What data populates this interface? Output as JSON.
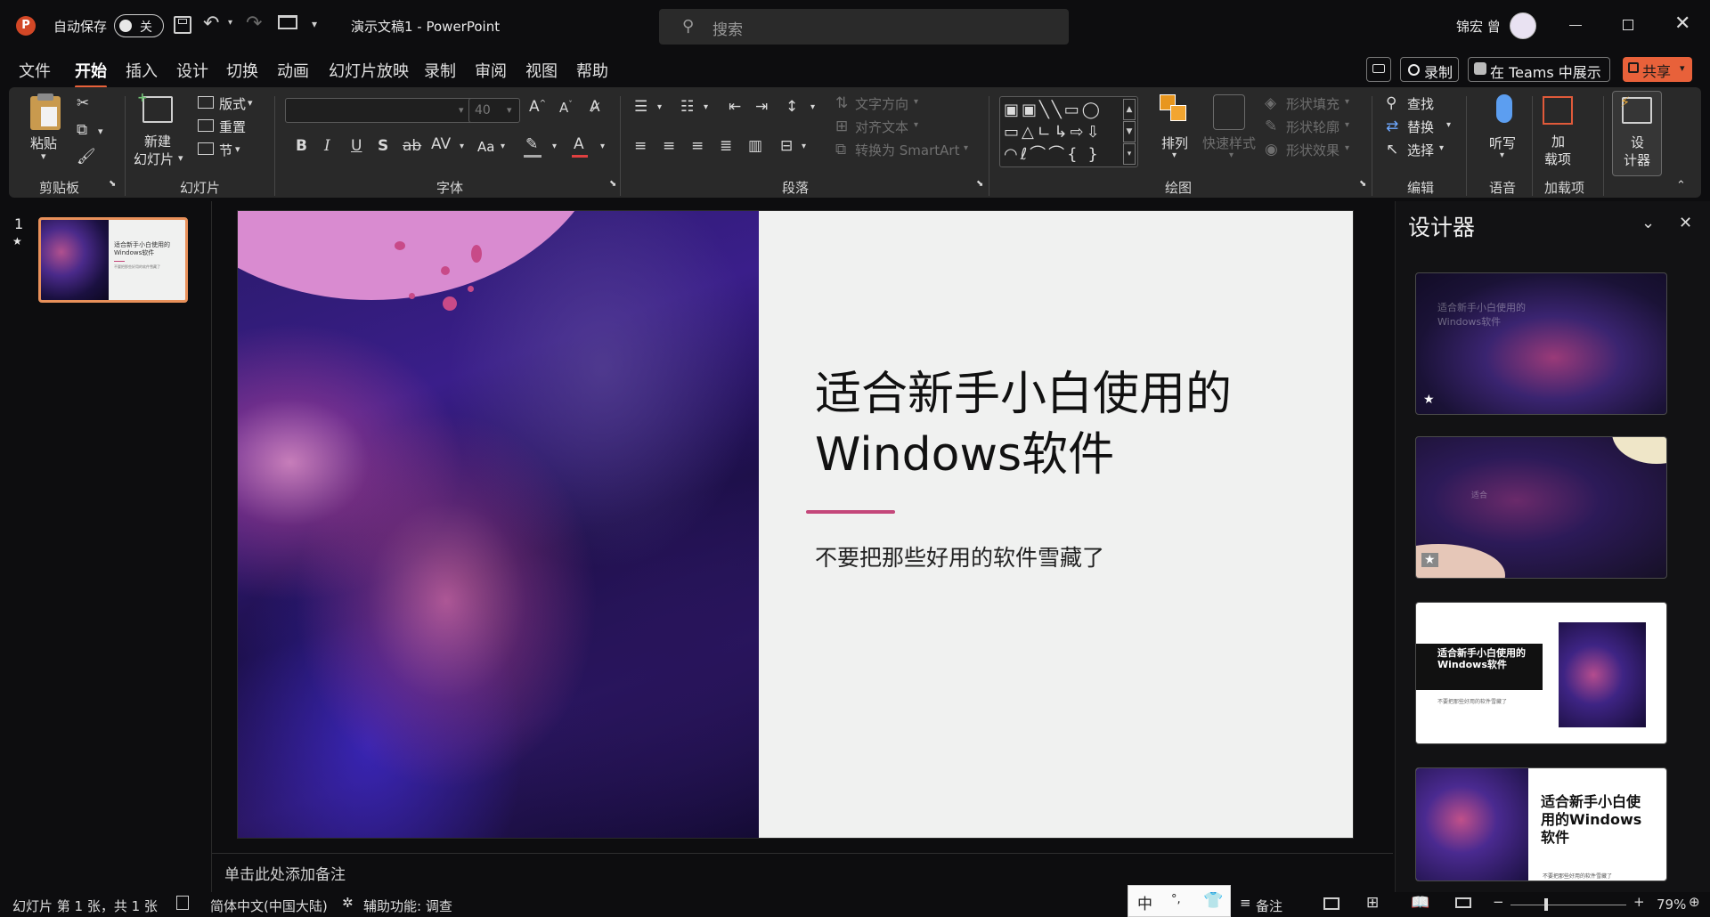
{
  "titlebar": {
    "autosave_label": "自动保存",
    "autosave_state": "关",
    "doc_title": "演示文稿1 - PowerPoint",
    "search_placeholder": "搜索",
    "user_name": "锦宏 曾"
  },
  "menu": {
    "tabs": [
      "文件",
      "开始",
      "插入",
      "设计",
      "切换",
      "动画",
      "幻灯片放映",
      "录制",
      "审阅",
      "视图",
      "帮助"
    ],
    "active": "开始",
    "record_btn": "录制",
    "teams_btn": "在 Teams 中展示",
    "share_btn": "共享"
  },
  "ribbon": {
    "clipboard": {
      "paste": "粘贴",
      "group": "剪贴板"
    },
    "slides": {
      "new_slide_1": "新建",
      "new_slide_2": "幻灯片",
      "layout": "版式",
      "reset": "重置",
      "section": "节",
      "group": "幻灯片"
    },
    "font": {
      "font_size": "40",
      "aa": "Aa",
      "group": "字体"
    },
    "paragraph": {
      "text_direction": "文字方向",
      "align_text": "对齐文本",
      "smartart": "转换为 SmartArt",
      "group": "段落"
    },
    "drawing": {
      "arrange": "排列",
      "quick_styles": "快速样式",
      "shape_fill": "形状填充",
      "shape_outline": "形状轮廓",
      "shape_effects": "形状效果",
      "group": "绘图"
    },
    "editing": {
      "find": "查找",
      "replace": "替换",
      "select": "选择",
      "group": "编辑"
    },
    "voice": {
      "dictate": "听写",
      "group": "语音"
    },
    "addins": {
      "addins_1": "加",
      "addins_2": "载项",
      "group": "加载项"
    },
    "designer_btn": {
      "line1": "设",
      "line2": "计器"
    }
  },
  "thumbnail": {
    "number": "1",
    "star": "★",
    "title": "适合新手小白使用的Windows软件",
    "subtitle": "不要把那些好用的软件雪藏了"
  },
  "slide": {
    "title_line1": "适合新手小白使用的",
    "title_line2": "Windows软件",
    "subtitle": "不要把那些好用的软件雪藏了",
    "accent_color": "#c4477a"
  },
  "notes": {
    "placeholder": "单击此处添加备注"
  },
  "designer": {
    "title": "设计器",
    "cards": [
      {
        "text": "适合新手小白使用的Windows软件"
      },
      {
        "text": "适合"
      },
      {
        "title": "适合新手小白使用的Windows软件",
        "subtitle": "不要把那些好用的软件雪藏了"
      },
      {
        "title": "适合新手小白使用的Windows软件",
        "subtitle": "不要把那些好用的软件雪藏了"
      }
    ],
    "star": "★"
  },
  "statusbar": {
    "slide_info": "幻灯片 第 1 张，共 1 张",
    "language": "简体中文(中国大陆)",
    "accessibility": "辅助功能: 调查",
    "ime_mode": "中",
    "ime_punct": "°,",
    "notes_btn": "备注",
    "zoom": "79%"
  },
  "colors": {
    "accent_orange": "#e8613a",
    "slide_bg": "#f0f1f0",
    "pink": "#d98bd0"
  }
}
